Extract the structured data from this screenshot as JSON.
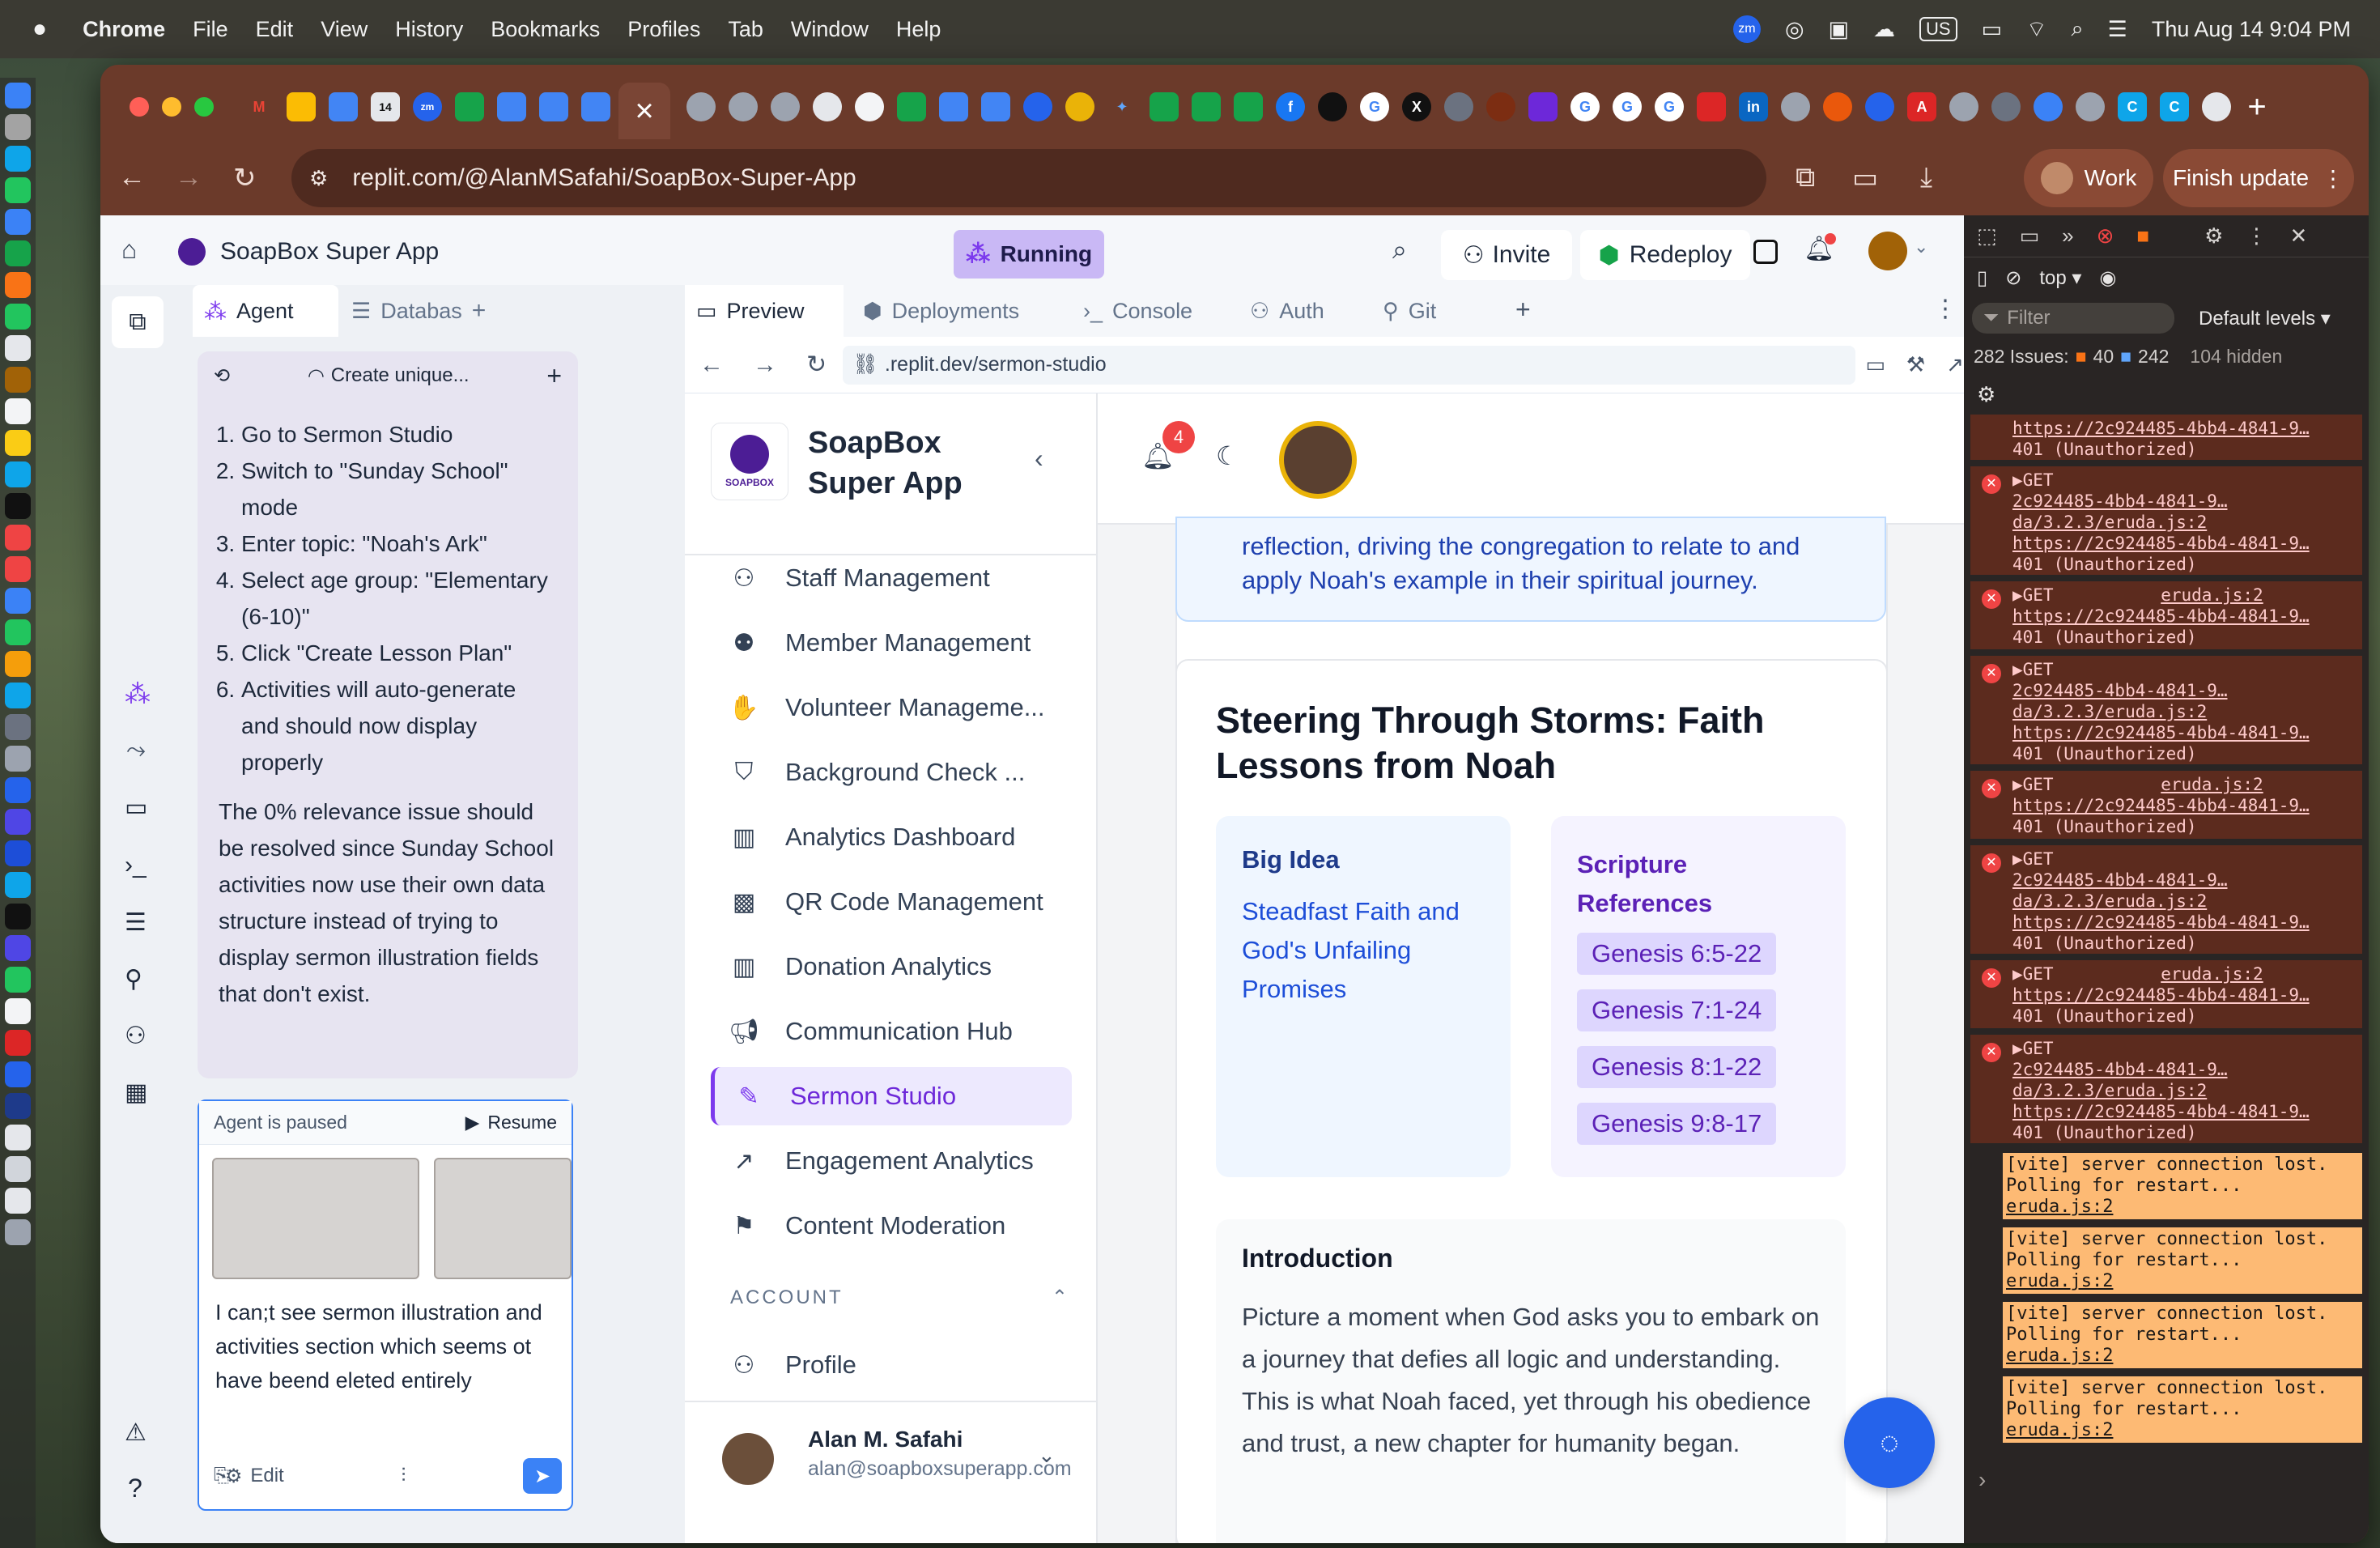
{
  "menubar": {
    "apple": "",
    "app": "Chrome",
    "items": [
      "File",
      "Edit",
      "View",
      "History",
      "Bookmarks",
      "Profiles",
      "Tab",
      "Window",
      "Help"
    ],
    "right": {
      "zoom": "zm",
      "keyboard": "US",
      "datetime": "Thu Aug 14  9:04 PM"
    }
  },
  "browser": {
    "tab_close": "×",
    "tab_new": "+",
    "url": "replit.com/@AlanMSafahi/SoapBox-Super-App",
    "profile": "Work",
    "finish_update": "Finish update",
    "more": "⋮"
  },
  "replit": {
    "project_name": "SoapBox Super App",
    "running": "Running",
    "invite": "Invite",
    "redeploy": "Redeploy"
  },
  "agent": {
    "tab_agent": "Agent",
    "tab_database": "Databas",
    "thread_title": "Create unique...",
    "steps": [
      "Go to Sermon Studio",
      "Switch to \"Sunday School\" mode",
      "Enter topic: \"Noah's Ark\"",
      "Select age group: \"Elementary (6-10)\"",
      "Click \"Create Lesson Plan\"",
      "Activities will auto-generate and should now display properly"
    ],
    "summary": "The 0% relevance issue should be resolved since Sunday School activities now use their own data structure instead of trying to display sermon illustration fields that don't exist.",
    "paused": "Agent is paused",
    "resume": "Resume",
    "input_text": "I can;t see sermon illustration and activities section which seems ot have beend eleted entirely",
    "edit": "Edit"
  },
  "preview": {
    "tabs": [
      "Preview",
      "Deployments",
      "Console",
      "Auth",
      "Git"
    ],
    "address": ".replit.dev/sermon-studio"
  },
  "app": {
    "logo_text": "SOAPBOX",
    "name_line1": "SoapBox",
    "name_line2": "Super App",
    "nav": [
      "Staff Management",
      "Member Management",
      "Volunteer Manageme...",
      "Background Check ...",
      "Analytics Dashboard",
      "QR Code Management",
      "Donation Analytics",
      "Communication Hub",
      "Sermon Studio",
      "Engagement Analytics",
      "Content Moderation"
    ],
    "account_heading": "ACCOUNT",
    "profile": "Profile",
    "user_name": "Alan M. Safahi",
    "user_email": "alan@soapboxsuperapp.com",
    "notif_count": "4"
  },
  "content": {
    "banner_line1": "reflection, driving the congregation to relate to and",
    "banner_line2": "apply Noah's example in their spiritual journey.",
    "title_line1": "Steering Through Storms: Faith",
    "title_line2": "Lessons from Noah",
    "big_idea_label": "Big Idea",
    "big_idea_text": "Steadfast Faith and God's Unfailing Promises",
    "scripture_label_1": "Scripture",
    "scripture_label_2": "References",
    "scriptures": [
      "Genesis 6:5-22",
      "Genesis 7:1-24",
      "Genesis 8:1-22",
      "Genesis 9:8-17"
    ],
    "intro_heading": "Introduction",
    "intro_text": "Picture a moment when God asks you to embark on a journey that defies all logic and understanding. This is what Noah faced, yet through his obedience and trust, a new chapter for humanity began."
  },
  "devtools": {
    "context": "top ▾",
    "filter": "Filter",
    "levels": "Default levels ▾",
    "issues": "282 Issues:",
    "issues_warn": "40",
    "issues_info": "242",
    "hidden": "104 hidden",
    "errors": [
      {
        "get": "",
        "src": "",
        "url": "https://2c924485-4bb4-4841-9…",
        "status": "401 (Unauthorized)",
        "partial": true
      },
      {
        "get": "▶GET",
        "src": "2c924485-4bb4-4841-9…da/3.2.3/eruda.js:2",
        "url": "https://2c924485-4bb4-4841-9…",
        "status": "401 (Unauthorized)",
        "partial": false
      },
      {
        "get": "▶GET",
        "src": "eruda.js:2",
        "url": "https://2c924485-4bb4-4841-9…",
        "status": "401 (Unauthorized)",
        "partial": false
      },
      {
        "get": "▶GET",
        "src": "2c924485-4bb4-4841-9…da/3.2.3/eruda.js:2",
        "url": "https://2c924485-4bb4-4841-9…",
        "status": "401 (Unauthorized)",
        "partial": false
      },
      {
        "get": "▶GET",
        "src": "eruda.js:2",
        "url": "https://2c924485-4bb4-4841-9…",
        "status": "401 (Unauthorized)",
        "partial": false
      },
      {
        "get": "▶GET",
        "src": "2c924485-4bb4-4841-9…da/3.2.3/eruda.js:2",
        "url": "https://2c924485-4bb4-4841-9…",
        "status": "401 (Unauthorized)",
        "partial": false
      },
      {
        "get": "▶GET",
        "src": "eruda.js:2",
        "url": "https://2c924485-4bb4-4841-9…",
        "status": "401 (Unauthorized)",
        "partial": false
      },
      {
        "get": "▶GET",
        "src": "2c924485-4bb4-4841-9…da/3.2.3/eruda.js:2",
        "url": "https://2c924485-4bb4-4841-9…",
        "status": "401 (Unauthorized)",
        "partial": false
      }
    ],
    "vite": [
      {
        "msg": "[vite] server connection lost. Polling for restart...",
        "src": "eruda.js:2"
      },
      {
        "msg": "[vite] server connection lost. Polling for restart...",
        "src": "eruda.js:2"
      },
      {
        "msg": "[vite] server connection lost. Polling for restart...",
        "src": "eruda.js:2"
      },
      {
        "msg": "[vite] server connection lost. Polling for restart...",
        "src": "eruda.js:2"
      }
    ],
    "prompt": "›"
  },
  "colors": {
    "accent": "#7c3aed",
    "brand_blue": "#1e40af",
    "error": "#ef4444"
  }
}
